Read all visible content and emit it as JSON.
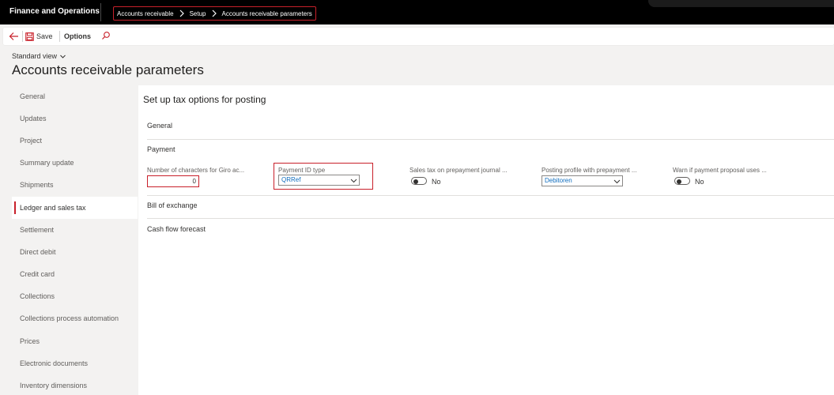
{
  "header": {
    "app_name": "Finance and Operations",
    "breadcrumb": [
      "Accounts receivable",
      "Setup",
      "Accounts receivable parameters"
    ]
  },
  "actions": {
    "save_label": "Save",
    "options_label": "Options"
  },
  "page": {
    "view": "Standard view",
    "title": "Accounts receivable parameters"
  },
  "sidebar": {
    "items": [
      {
        "label": "General"
      },
      {
        "label": "Updates"
      },
      {
        "label": "Project"
      },
      {
        "label": "Summary update"
      },
      {
        "label": "Shipments"
      },
      {
        "label": "Ledger and sales tax",
        "active": true
      },
      {
        "label": "Settlement"
      },
      {
        "label": "Direct debit"
      },
      {
        "label": "Credit card"
      },
      {
        "label": "Collections"
      },
      {
        "label": "Collections process automation"
      },
      {
        "label": "Prices"
      },
      {
        "label": "Electronic documents"
      },
      {
        "label": "Inventory dimensions"
      }
    ]
  },
  "main": {
    "section_title": "Set up tax options for posting",
    "groups": {
      "general": "General",
      "payment": "Payment",
      "bill_of_exchange": "Bill of exchange",
      "cash_flow": "Cash flow forecast"
    },
    "fields": {
      "giro_label": "Number of characters for Giro ac...",
      "giro_value": "0",
      "payment_id_label": "Payment ID type",
      "payment_id_value": "QRRef",
      "sales_tax_label": "Sales tax on prepayment journal ...",
      "sales_tax_value": "No",
      "posting_profile_label": "Posting profile with prepayment ...",
      "posting_profile_value": "Debitoren",
      "warn_label": "Warn if payment proposal uses ...",
      "warn_value": "No"
    }
  },
  "colors": {
    "accent_red": "#c8202a",
    "link_blue": "#0f6cbd",
    "topbar": "#000000"
  }
}
